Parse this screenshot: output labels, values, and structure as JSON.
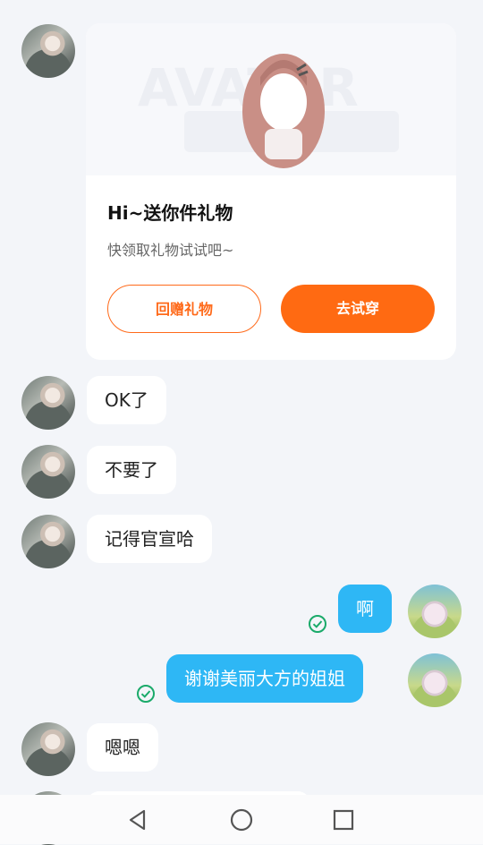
{
  "gift_card": {
    "title": "Hi~送你件礼物",
    "subtitle": "快领取礼物试试吧~",
    "return_gift_label": "回赠礼物",
    "try_on_label": "去试穿",
    "banner_text": "AVATAR"
  },
  "messages": [
    {
      "from": "her",
      "text": "OK了"
    },
    {
      "from": "her",
      "text": "不要了"
    },
    {
      "from": "her",
      "text": "记得官宣哈"
    },
    {
      "from": "me",
      "text": "啊",
      "status": "sent"
    },
    {
      "from": "me",
      "text": "谢谢美丽大方的姐姐",
      "status": "sent"
    },
    {
      "from": "her",
      "text": "嗯嗯"
    }
  ],
  "colors": {
    "background": "#f3f5f9",
    "my_bubble": "#2eb7f5",
    "accent_orange": "#ff6a12",
    "check_green": "#1aaa6a"
  },
  "navbar": {
    "icons": [
      "back-triangle-icon",
      "home-circle-icon",
      "recents-square-icon"
    ]
  }
}
